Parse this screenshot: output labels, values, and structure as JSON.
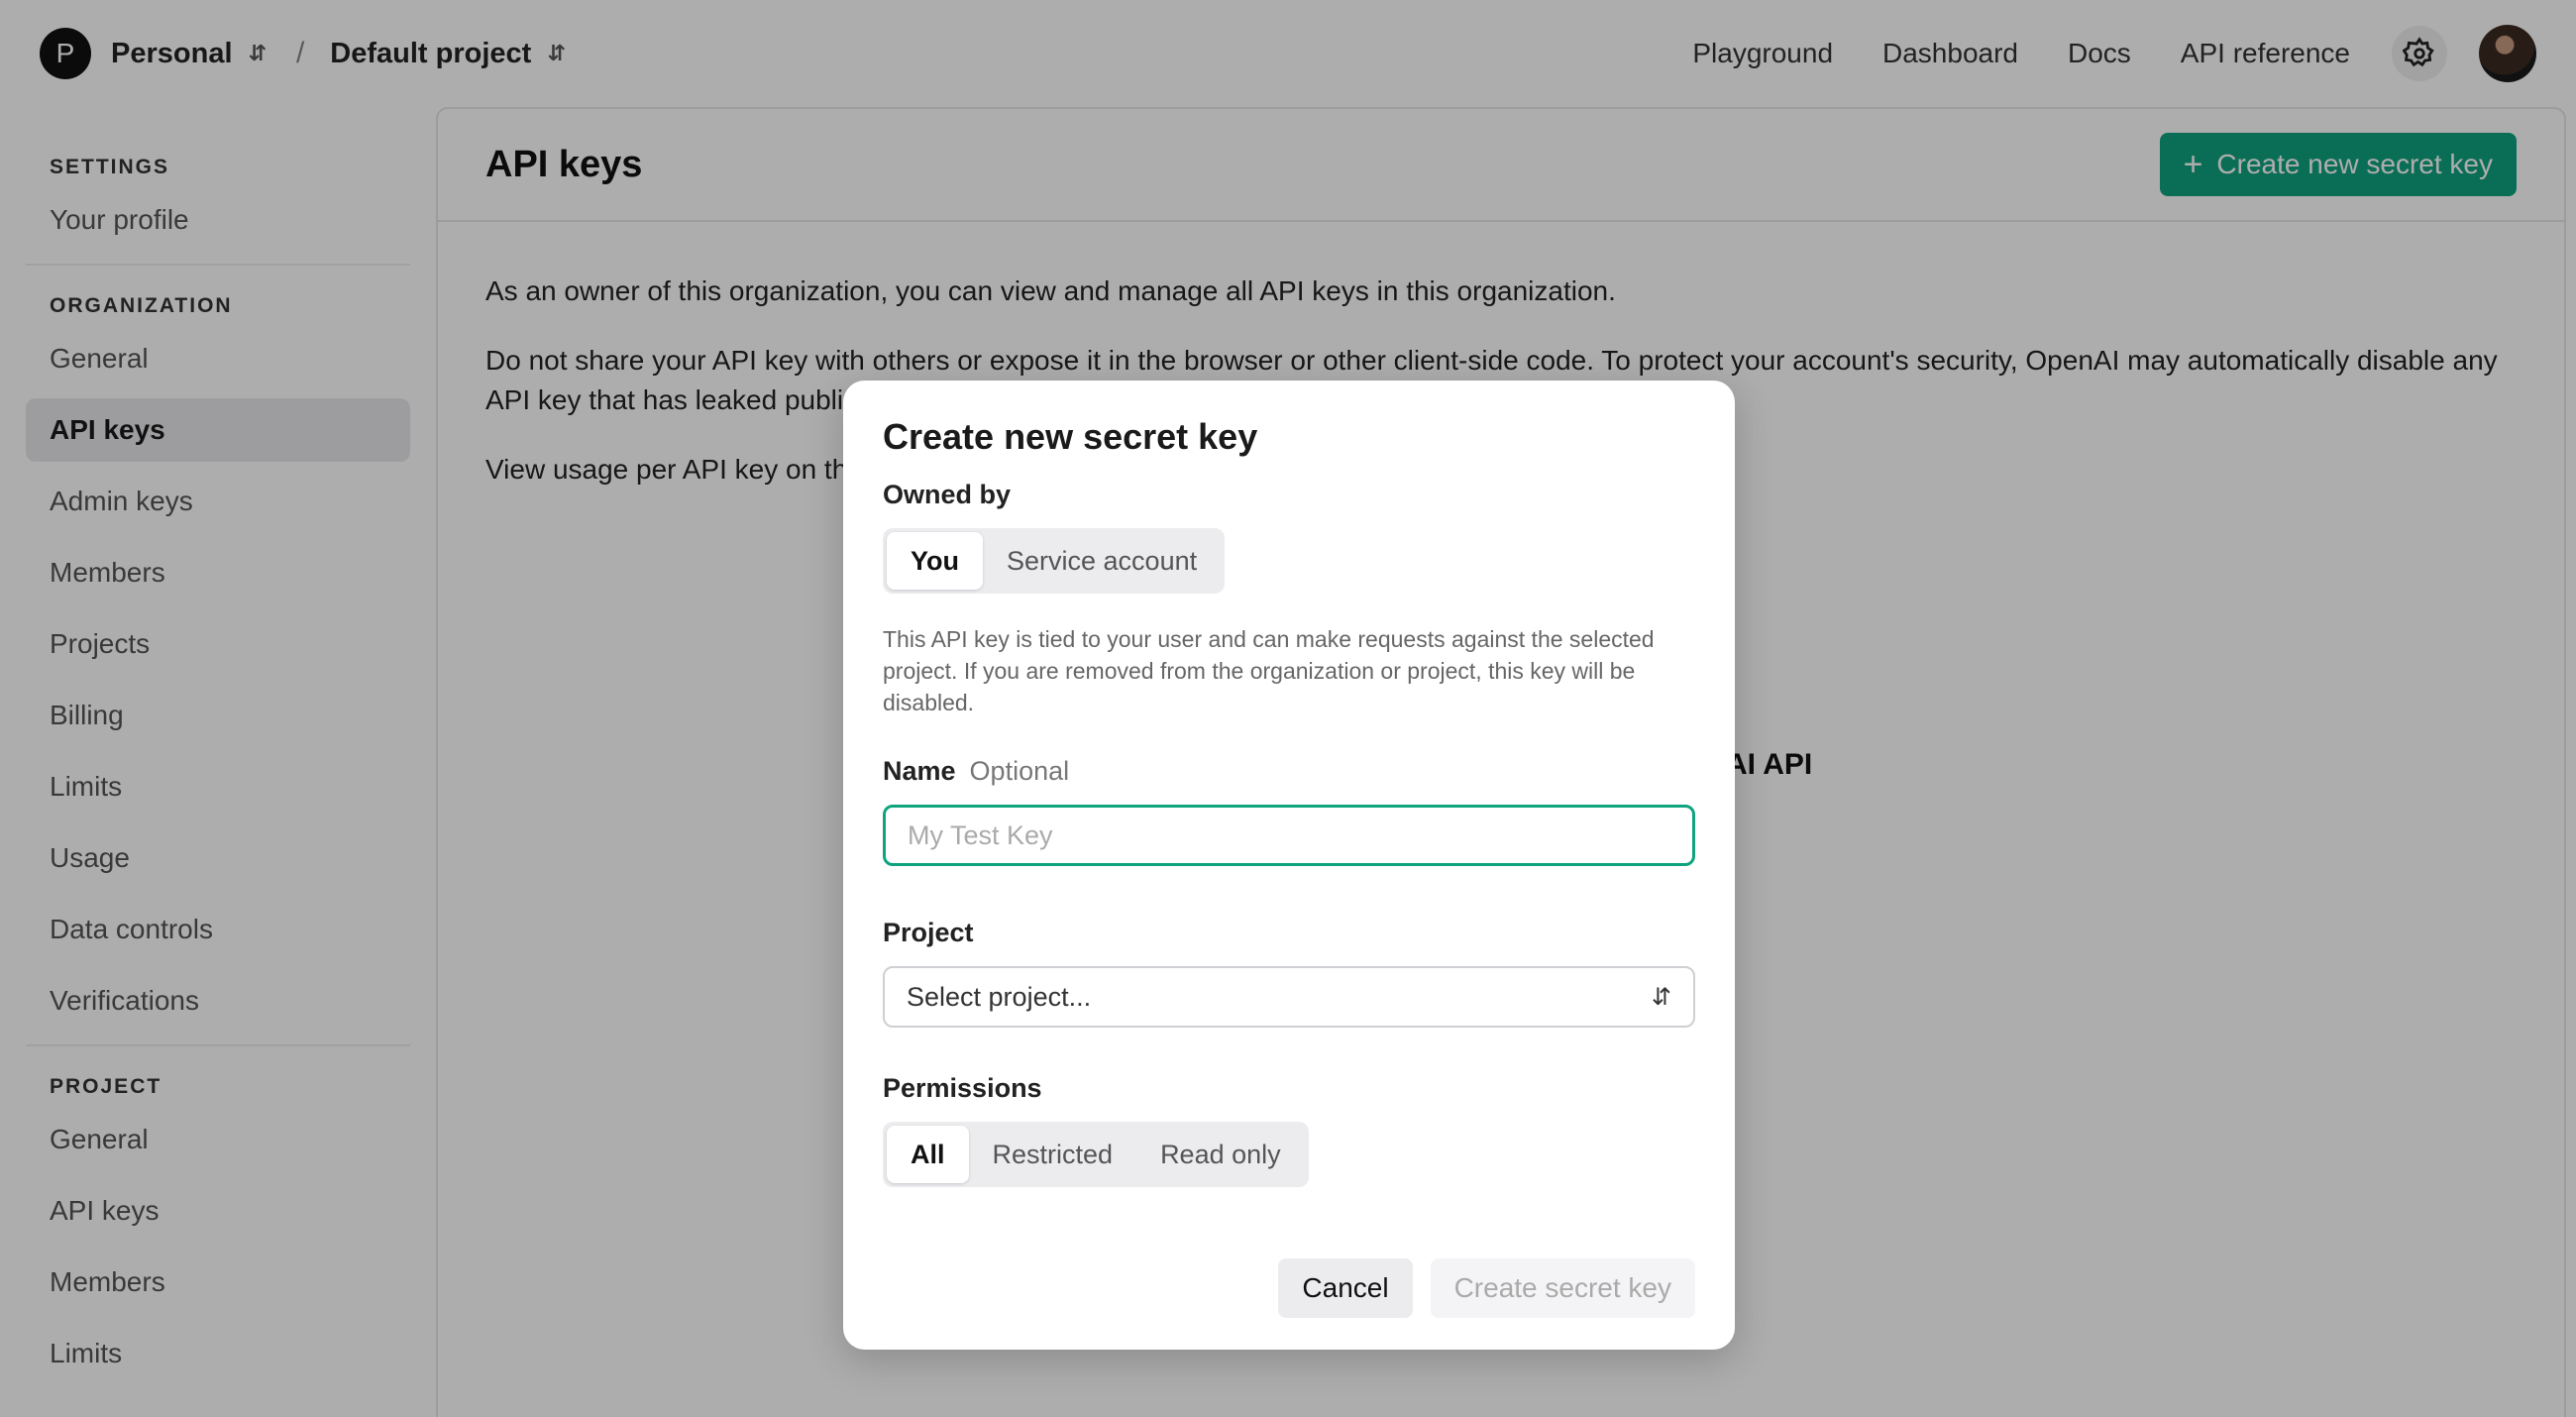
{
  "topbar": {
    "org_initial": "P",
    "org_name": "Personal",
    "project_name": "Default project",
    "separator": "/",
    "nav": [
      "Playground",
      "Dashboard",
      "Docs",
      "API reference"
    ]
  },
  "sidebar": {
    "settings_head": "SETTINGS",
    "settings_items": [
      "Your profile"
    ],
    "org_head": "ORGANIZATION",
    "org_items": [
      "General",
      "API keys",
      "Admin keys",
      "Members",
      "Projects",
      "Billing",
      "Limits",
      "Usage",
      "Data controls",
      "Verifications"
    ],
    "project_head": "PROJECT",
    "project_items": [
      "General",
      "API keys",
      "Members",
      "Limits"
    ]
  },
  "main": {
    "title": "API keys",
    "create_label": "Create new secret key",
    "para1": "As an owner of this organization, you can view and manage all API keys in this organization.",
    "para2": "Do not share your API key with others or expose it in the browser or other client-side code. To protect your account's security, OpenAI may automatically disable any API key that has leaked publicly.",
    "para3": "View usage per API key on the",
    "ghost": "AI API"
  },
  "modal": {
    "title": "Create new secret key",
    "owned_by_label": "Owned by",
    "owner_options": [
      "You",
      "Service account"
    ],
    "owner_selected": "You",
    "help_text": "This API key is tied to your user and can make requests against the selected project. If you are removed from the organization or project, this key will be disabled.",
    "name_label": "Name",
    "name_optional": "Optional",
    "name_placeholder": "My Test Key",
    "name_value": "",
    "project_label": "Project",
    "project_placeholder": "Select project...",
    "permissions_label": "Permissions",
    "permission_options": [
      "All",
      "Restricted",
      "Read only"
    ],
    "permission_selected": "All",
    "cancel_label": "Cancel",
    "create_label": "Create secret key"
  },
  "colors": {
    "accent": "#10a37f",
    "overlay": "rgba(0,0,0,0.32)"
  }
}
